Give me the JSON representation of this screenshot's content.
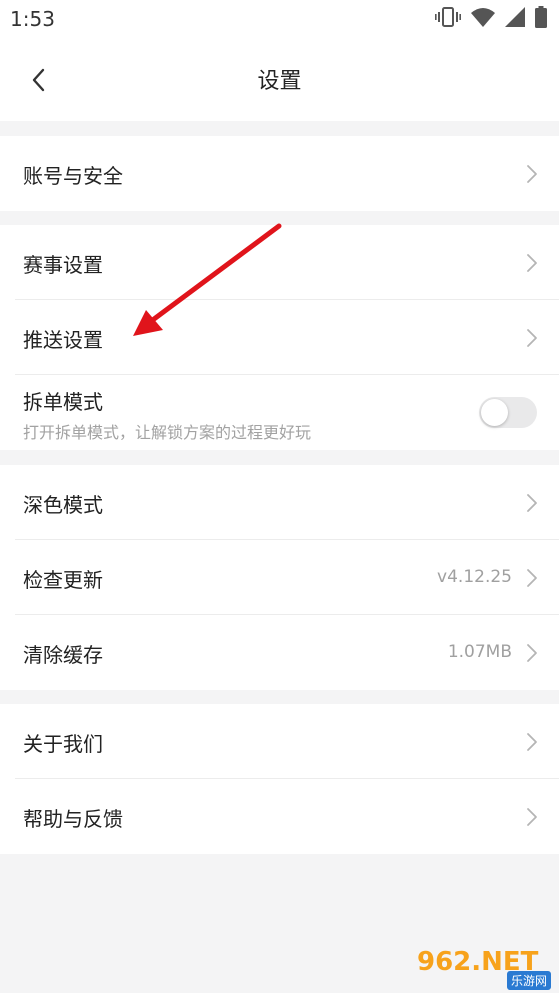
{
  "status_bar": {
    "time": "1:53",
    "icons": [
      "vibrate-icon",
      "wifi-icon",
      "signal-icon",
      "battery-icon"
    ]
  },
  "header": {
    "title": "设置",
    "back_icon": "chevron-left-icon"
  },
  "groups": [
    {
      "items": [
        {
          "label": "账号与安全"
        }
      ]
    },
    {
      "items": [
        {
          "label": "赛事设置"
        },
        {
          "label": "推送设置"
        },
        {
          "label": "拆单模式",
          "subtitle": "打开拆单模式，让解锁方案的过程更好玩",
          "toggle_on": false
        }
      ]
    },
    {
      "items": [
        {
          "label": "深色模式"
        },
        {
          "label": "检查更新",
          "value": "v4.12.25"
        },
        {
          "label": "清除缓存",
          "value": "1.07MB"
        }
      ]
    },
    {
      "items": [
        {
          "label": "关于我们"
        },
        {
          "label": "帮助与反馈"
        }
      ]
    }
  ],
  "watermark": {
    "main": "962.NET",
    "sub": "乐游网"
  },
  "colors": {
    "background": "#f4f4f5",
    "annotation_arrow": "#e0141b",
    "toggle_off": "#e9e9ea",
    "chevron": "#b5b5b5"
  }
}
